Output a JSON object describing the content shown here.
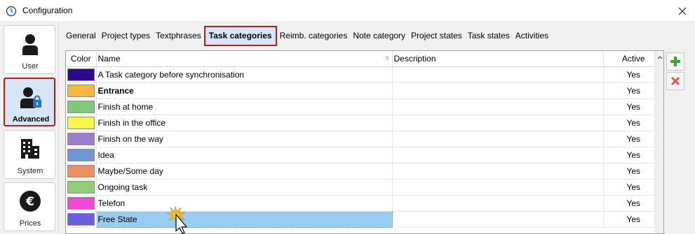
{
  "window": {
    "title": "Configuration"
  },
  "nav": {
    "items": [
      {
        "label": "User",
        "icon": "user-icon",
        "active": false
      },
      {
        "label": "Advanced",
        "icon": "user-lock-icon",
        "active": true
      },
      {
        "label": "System",
        "icon": "building-icon",
        "active": false
      },
      {
        "label": "Prices",
        "icon": "euro-icon",
        "active": false
      }
    ]
  },
  "tabs": [
    {
      "label": "General",
      "active": false
    },
    {
      "label": "Project types",
      "active": false
    },
    {
      "label": "Textphrases",
      "active": false
    },
    {
      "label": "Task categories",
      "active": true
    },
    {
      "label": "Reimb. categories",
      "active": false
    },
    {
      "label": "Note category",
      "active": false
    },
    {
      "label": "Project states",
      "active": false
    },
    {
      "label": "Task states",
      "active": false
    },
    {
      "label": "Activities",
      "active": false
    }
  ],
  "grid": {
    "columns": {
      "color": "Color",
      "name": "Name",
      "description": "Description",
      "active": "Active"
    },
    "rows": [
      {
        "color": "#2b0a8f",
        "name": "A Task category before synchronisation",
        "description": "",
        "active": "Yes"
      },
      {
        "color": "#f5b942",
        "name": "Entrance",
        "description": "",
        "active": "Yes",
        "bold": true
      },
      {
        "color": "#80c87a",
        "name": "Finish at home",
        "description": "",
        "active": "Yes"
      },
      {
        "color": "#f7f74a",
        "name": "Finish in the office",
        "description": "",
        "active": "Yes"
      },
      {
        "color": "#9b7ecb",
        "name": "Finish on the way",
        "description": "",
        "active": "Yes"
      },
      {
        "color": "#6f97d2",
        "name": "Idea",
        "description": "",
        "active": "Yes"
      },
      {
        "color": "#ec8f5c",
        "name": "Maybe/Some day",
        "description": "",
        "active": "Yes"
      },
      {
        "color": "#90cf78",
        "name": "Ongoing task",
        "description": "",
        "active": "Yes"
      },
      {
        "color": "#ee4ad6",
        "name": "Telefon",
        "description": "",
        "active": "Yes"
      },
      {
        "color": "#6b5ee0",
        "name": "Free State",
        "description": "",
        "active": "Yes",
        "selected": true
      }
    ]
  },
  "actions": {
    "add_icon": "plus-icon",
    "remove_icon": "remove-icon"
  },
  "colors": {
    "accent_highlight": "#b11d23",
    "selection": "#99ccf3",
    "active_bg": "#d7e6f7"
  }
}
